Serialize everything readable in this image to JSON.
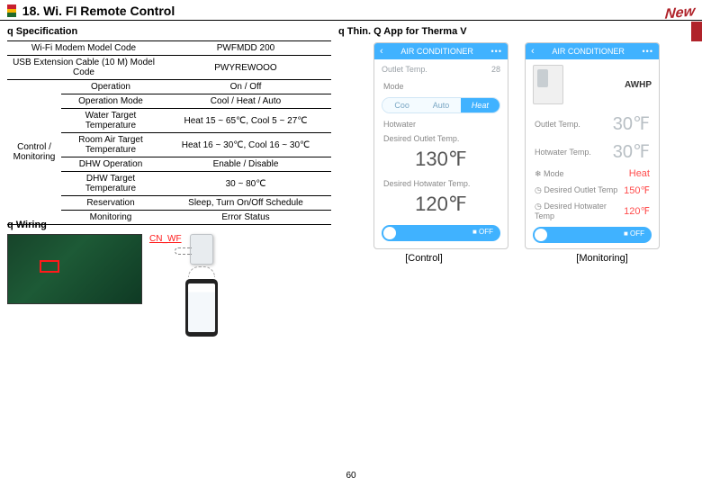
{
  "title": "18. Wi. FI Remote Control",
  "badge_new": "New",
  "page_number": "60",
  "left": {
    "spec_header": "q Specification",
    "wiring_header": "q Wiring",
    "table": {
      "r1_l": "Wi-Fi Modem Model Code",
      "r1_v": "PWFMDD 200",
      "r2_l": "USB Extension Cable (10 M) Model Code",
      "r2_v": "PWYREWOOO",
      "group": "Control / Monitoring",
      "r3_l": "Operation",
      "r3_v": "On / Off",
      "r4_l": "Operation Mode",
      "r4_v": "Cool / Heat / Auto",
      "r5_l": "Water Target Temperature",
      "r5_v": "Heat 15 ~ 65℃, Cool 5 ~ 27℃",
      "r6_l": "Room Air Target Temperature",
      "r6_v": "Heat 16 ~ 30℃, Cool 16 ~ 30℃",
      "r7_l": "DHW Operation",
      "r7_v": "Enable / Disable",
      "r8_l": "DHW Target Temperature",
      "r8_v": "30 ~ 80℃",
      "r9_l": "Reservation",
      "r9_v": "Sleep, Turn On/Off Schedule",
      "r10_l": "Monitoring",
      "r10_v": "Error Status"
    },
    "cn_wf": "CN_WF"
  },
  "right": {
    "app_header": "q Thin. Q App for Therma V",
    "phoneA": {
      "top": "AIR CONDITIONER",
      "sub_label": "Outlet Temp.",
      "sub_value": "28",
      "mode_label": "Mode",
      "seg_cool": "Coo",
      "seg_auto": "Auto",
      "seg_heat": "Heat",
      "hotwater_label": "Hotwater",
      "desired_outlet_label": "Desired Outlet Temp.",
      "desired_outlet_value": "130℉",
      "desired_hotwater_label": "Desired Hotwater Temp.",
      "desired_hotwater_value": "120℉",
      "toggle": "■ OFF",
      "caption": "[Control]"
    },
    "phoneB": {
      "top": "AIR CONDITIONER",
      "device_name": "AWHP",
      "outlet_label": "Outlet Temp.",
      "outlet_value": "30℉",
      "hotwater_label": "Hotwater Temp.",
      "hotwater_value": "30℉",
      "mode_label": "Mode",
      "mode_value": "Heat",
      "d_outlet_label": "Desired Outlet Temp",
      "d_outlet_value": "150℉",
      "d_hot_label": "Desired Hotwater Temp",
      "d_hot_value": "120℉",
      "toggle": "■ OFF",
      "caption": "[Monitoring]"
    }
  }
}
